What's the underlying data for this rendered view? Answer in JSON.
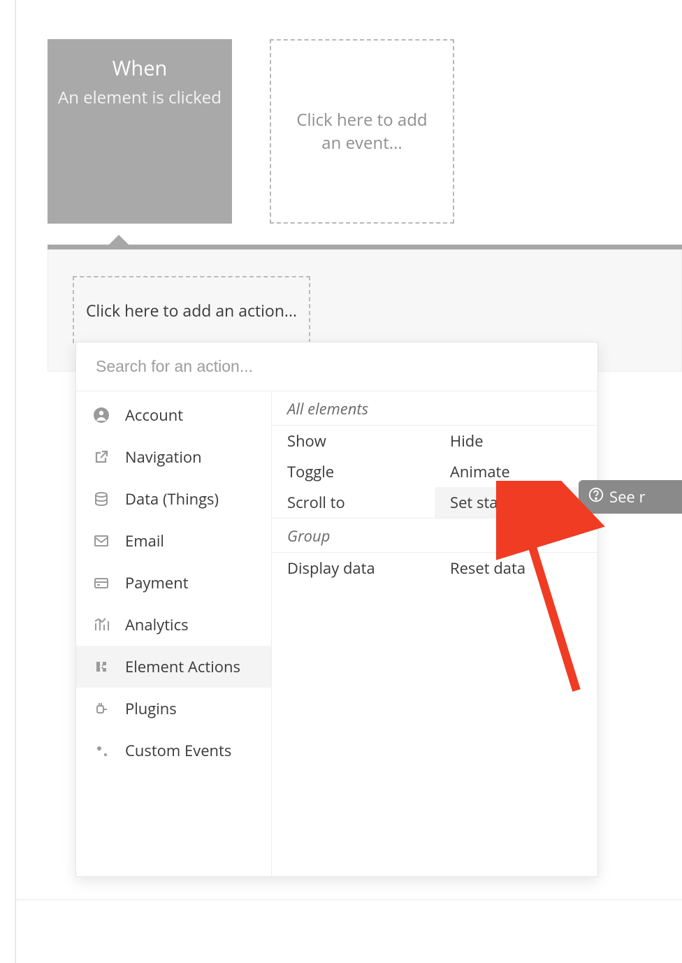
{
  "event": {
    "title": "When",
    "subtitle": "An element is clicked"
  },
  "add_event_label": "Click here to add an event...",
  "add_action_label": "Click here to add an action...",
  "search_placeholder": "Search for an action...",
  "categories": {
    "account": "Account",
    "navigation": "Navigation",
    "data": "Data (Things)",
    "email": "Email",
    "payment": "Payment",
    "analytics": "Analytics",
    "element_actions": "Element Actions",
    "plugins": "Plugins",
    "custom_events": "Custom Events"
  },
  "action_groups": {
    "all_elements": {
      "header": "All elements",
      "items": {
        "show": "Show",
        "hide": "Hide",
        "toggle": "Toggle",
        "animate": "Animate",
        "scroll_to": "Scroll to",
        "set_state": "Set state"
      }
    },
    "group": {
      "header": "Group",
      "items": {
        "display_data": "Display data",
        "reset_data": "Reset data"
      }
    }
  },
  "see_reference_label": "See r"
}
